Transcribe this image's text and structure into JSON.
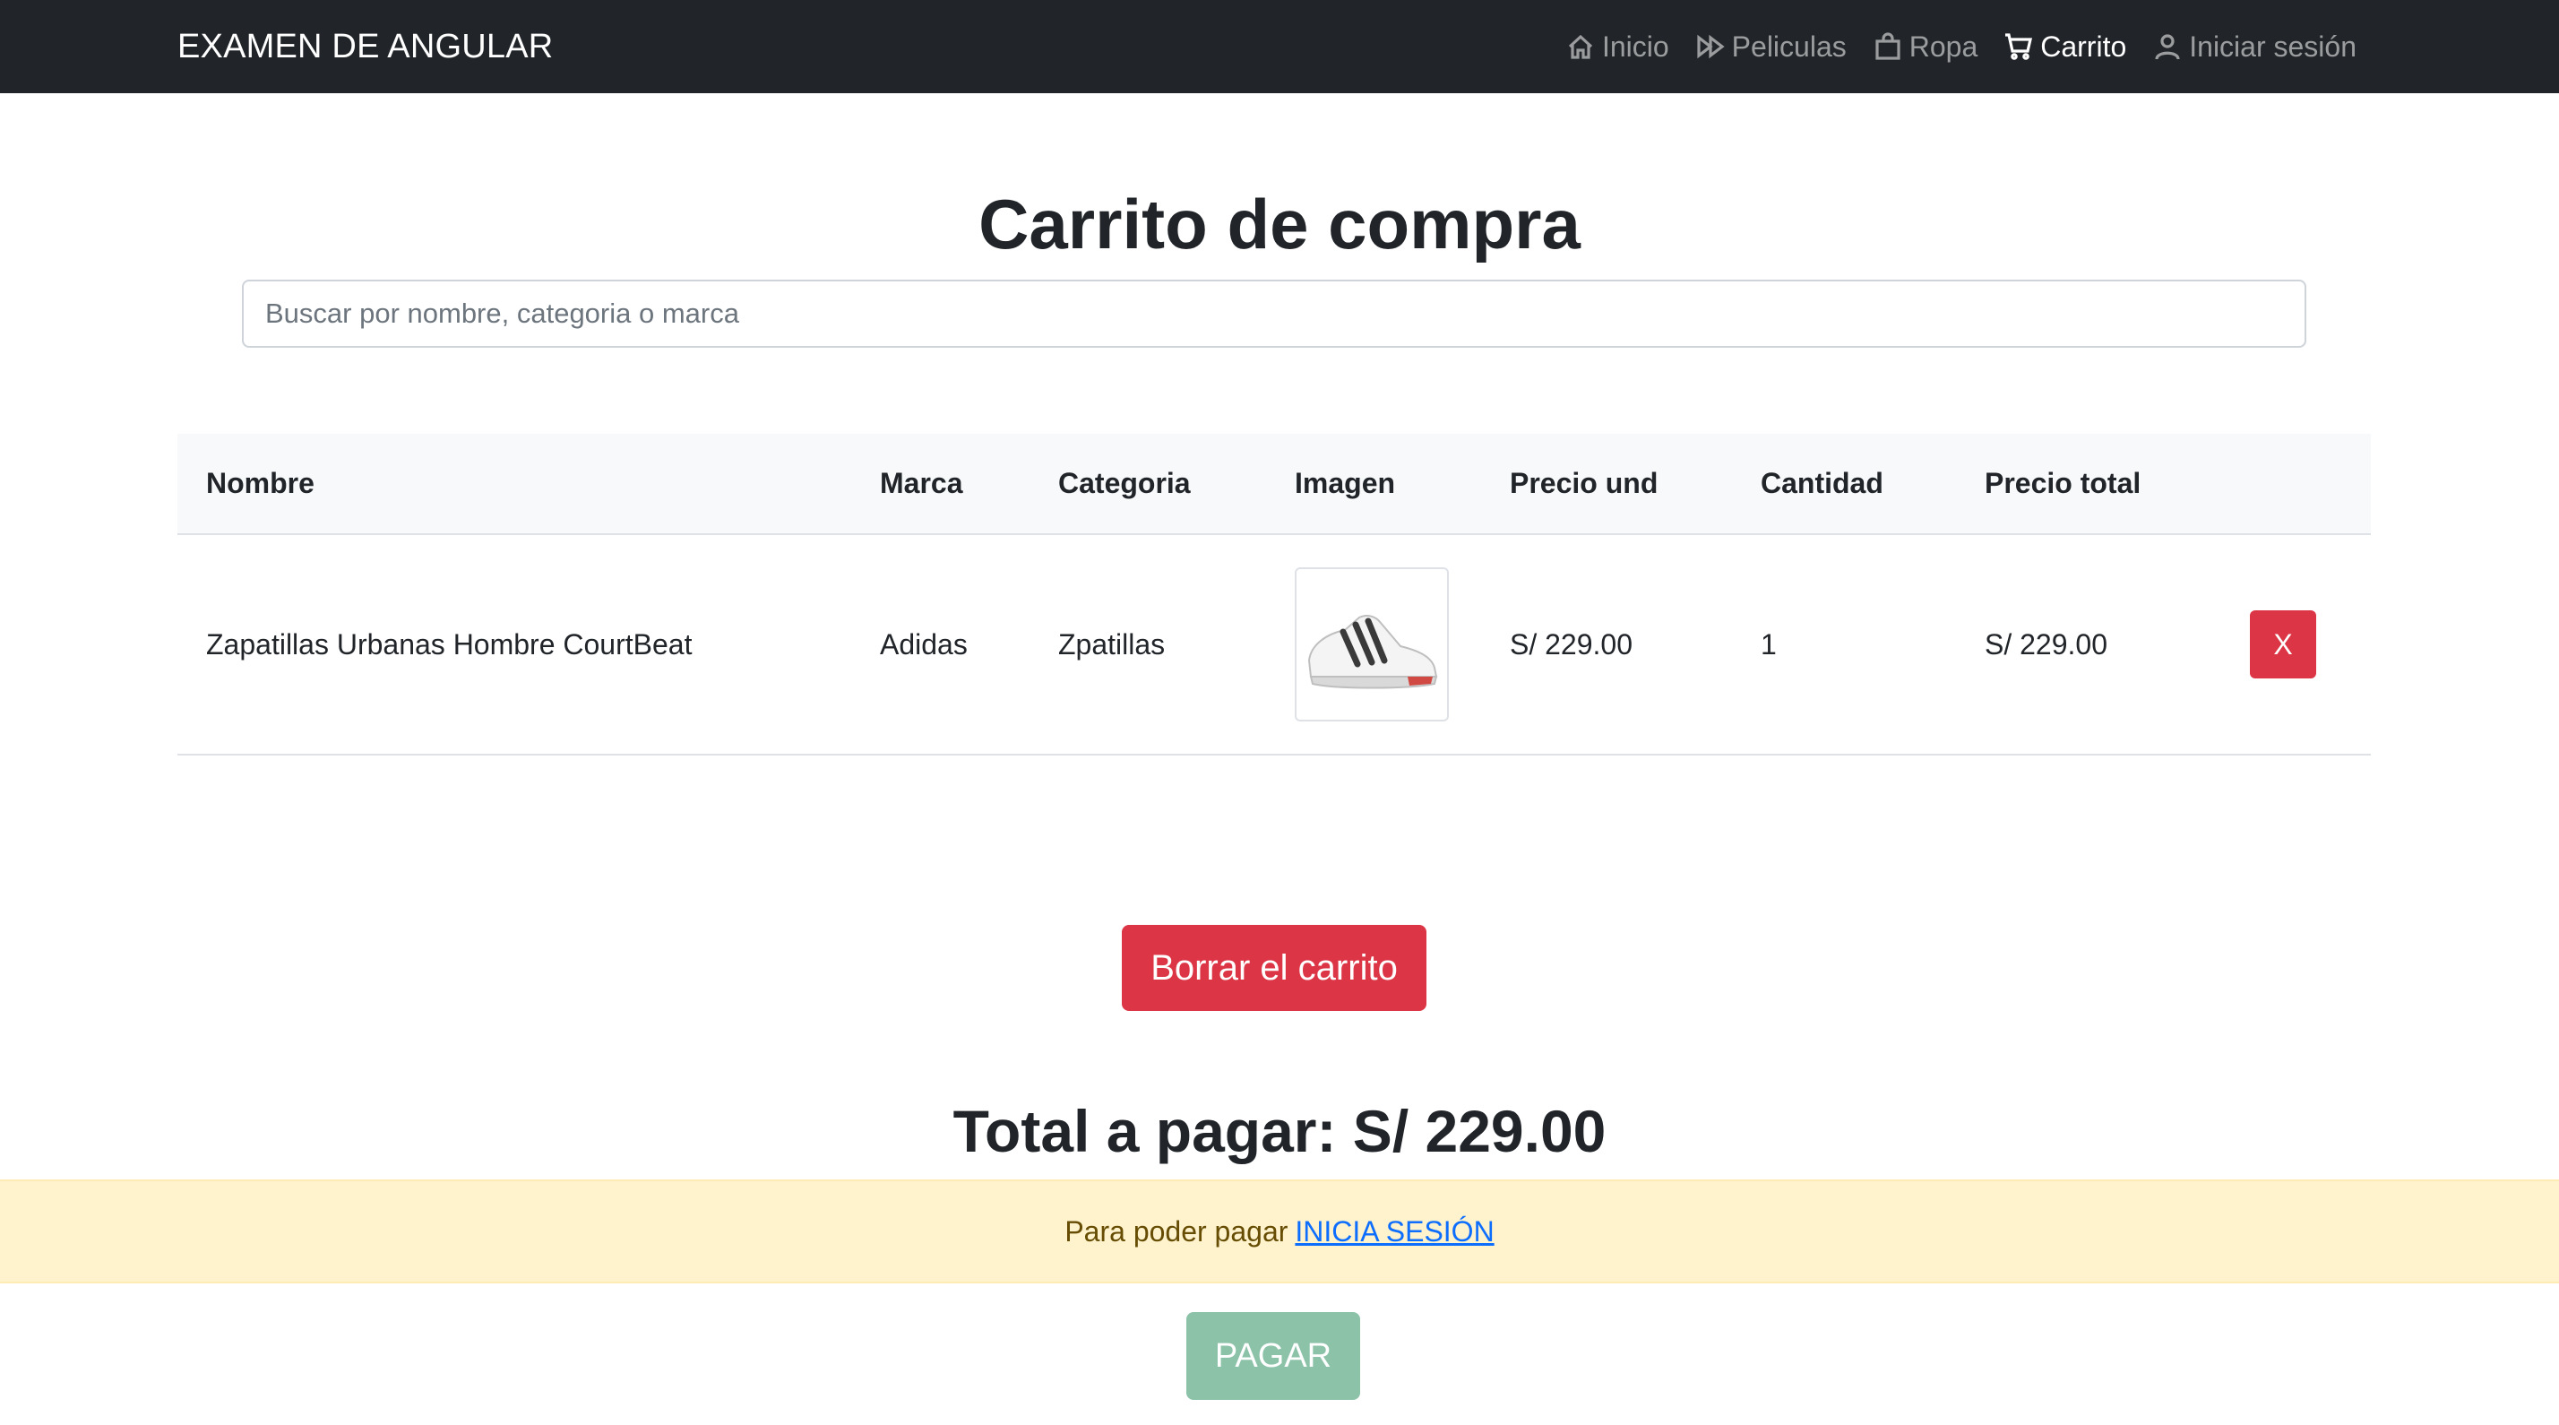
{
  "navbar": {
    "brand": "EXAMEN DE ANGULAR",
    "links": [
      {
        "label": "Inicio",
        "icon": "house-icon"
      },
      {
        "label": "Peliculas",
        "icon": "fast-forward-icon"
      },
      {
        "label": "Ropa",
        "icon": "shopping-bag-icon"
      },
      {
        "label": "Carrito",
        "icon": "cart-icon",
        "active": true
      },
      {
        "label": "Iniciar sesión",
        "icon": "person-icon"
      }
    ]
  },
  "page": {
    "title": "Carrito de compra",
    "search_placeholder": "Buscar por nombre, categoria o marca"
  },
  "table": {
    "headers": [
      "Nombre",
      "Marca",
      "Categoria",
      "Imagen",
      "Precio und",
      "Cantidad",
      "Precio total"
    ],
    "rows": [
      {
        "nombre": "Zapatillas Urbanas Hombre CourtBeat",
        "marca": "Adidas",
        "categoria": "Zpatillas",
        "image_icon": "sneaker-image",
        "precio_und": "S/ 229.00",
        "cantidad": "1",
        "precio_total": "S/ 229.00",
        "remove_label": "X"
      }
    ]
  },
  "actions": {
    "clear_label": "Borrar el carrito",
    "total_text": "Total a pagar: S/ 229.00",
    "pay_label": "PAGAR"
  },
  "alert": {
    "text": "Para poder pagar",
    "link_label": "INICIA SESIÓN"
  },
  "colors": {
    "navbar_bg": "#212529",
    "danger": "#dc3545",
    "success_disabled": "#198754",
    "alert_bg": "#fff3cd",
    "link": "#0d6efd"
  }
}
